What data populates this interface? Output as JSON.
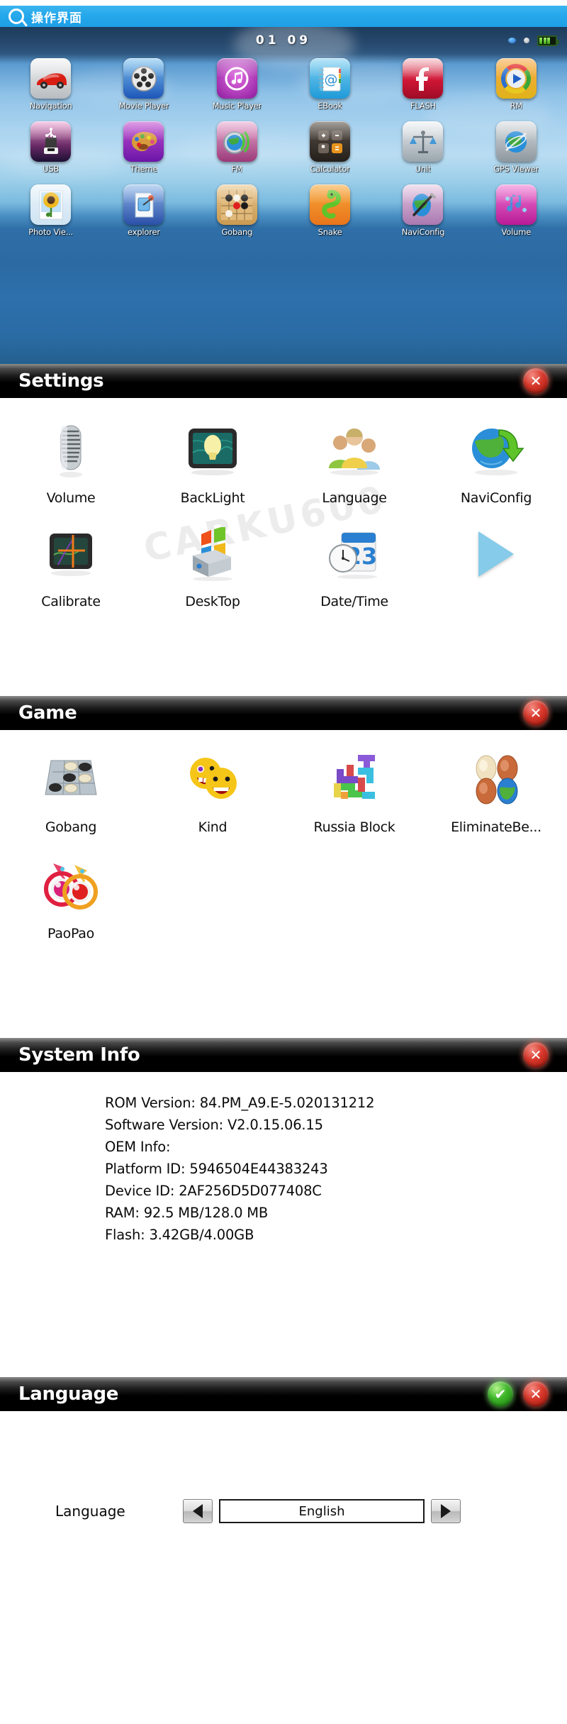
{
  "titlebar": {
    "title": "操作界面",
    "search_icon": "search-lens-icon"
  },
  "desktop": {
    "clock": "01  09",
    "status_icons": [
      "signal-dot-blue",
      "signal-dot-grey",
      "battery-icon"
    ],
    "rows": [
      [
        {
          "label": "Navigation",
          "icon": "car-icon"
        },
        {
          "label": "Movie Player",
          "icon": "film-reel-icon"
        },
        {
          "label": "Music Player",
          "icon": "music-note-icon"
        },
        {
          "label": "EBook",
          "icon": "notebook-at-icon"
        },
        {
          "label": "FLASH",
          "icon": "flash-f-icon"
        },
        {
          "label": "RM",
          "icon": "realplayer-icon"
        }
      ],
      [
        {
          "label": "USB",
          "icon": "usb-drive-icon"
        },
        {
          "label": "Theme",
          "icon": "palette-icon"
        },
        {
          "label": "FM",
          "icon": "globe-radio-icon"
        },
        {
          "label": "Calculator",
          "icon": "calculator-keys-icon"
        },
        {
          "label": "Unit",
          "icon": "scales-icon"
        },
        {
          "label": "GPS Viewer",
          "icon": "globe-satellite-icon"
        }
      ],
      [
        {
          "label": "Photo Vie...",
          "icon": "sunflower-photo-icon"
        },
        {
          "label": "explorer",
          "icon": "file-explorer-icon"
        },
        {
          "label": "Gobang",
          "icon": "gobang-board-icon"
        },
        {
          "label": "Snake",
          "icon": "snake-icon"
        },
        {
          "label": "NaviConfig",
          "icon": "globe-pen-icon"
        },
        {
          "label": "Volume",
          "icon": "volume-note-icon"
        }
      ]
    ]
  },
  "settings": {
    "title": "Settings",
    "close_label": "✕",
    "watermark": "CARKU600",
    "rows": [
      [
        {
          "label": "Volume",
          "icon": "microphone-icon"
        },
        {
          "label": "BackLight",
          "icon": "backlight-bulb-icon"
        },
        {
          "label": "Language",
          "icon": "people-group-icon"
        },
        {
          "label": "NaviConfig",
          "icon": "globe-arrow-icon"
        }
      ],
      [
        {
          "label": "Calibrate",
          "icon": "calibrate-crosshair-icon"
        },
        {
          "label": "DeskTop",
          "icon": "windows-desktop-icon"
        },
        {
          "label": "Date/Time",
          "icon": "calendar-clock-icon"
        },
        {
          "label": "",
          "icon": "next-page-arrow-icon"
        }
      ]
    ]
  },
  "game": {
    "title": "Game",
    "close_label": "✕",
    "rows": [
      [
        {
          "label": "Gobang",
          "icon": "gobang-board-icon"
        },
        {
          "label": "Kind",
          "icon": "smiley-faces-icon"
        },
        {
          "label": "Russia Block",
          "icon": "tetris-blocks-icon"
        },
        {
          "label": "EliminateBe...",
          "icon": "eliminate-beads-icon"
        }
      ],
      [
        {
          "label": "PaoPao",
          "icon": "paopao-bubbles-icon"
        }
      ]
    ]
  },
  "system_info": {
    "title": "System Info",
    "close_label": "✕",
    "lines": [
      "ROM Version: 84.PM_A9.E-5.020131212",
      "Software Version: V2.0.15.06.15",
      "OEM Info:",
      "Platform ID: 5946504E44383243",
      "Device ID: 2AF256D5D077408C",
      "RAM: 92.5 MB/128.0 MB",
      "Flash: 3.42GB/4.00GB"
    ]
  },
  "language": {
    "title": "Language",
    "ok_label": "✔",
    "close_label": "✕",
    "field_label": "Language",
    "value": "English",
    "prev_icon": "arrow-left-icon",
    "next_icon": "arrow-right-icon"
  },
  "colors": {
    "titlebar": "#25a8ec",
    "panel_header": "#000000",
    "close_btn": "#d8392c",
    "ok_btn": "#3fb72a"
  }
}
